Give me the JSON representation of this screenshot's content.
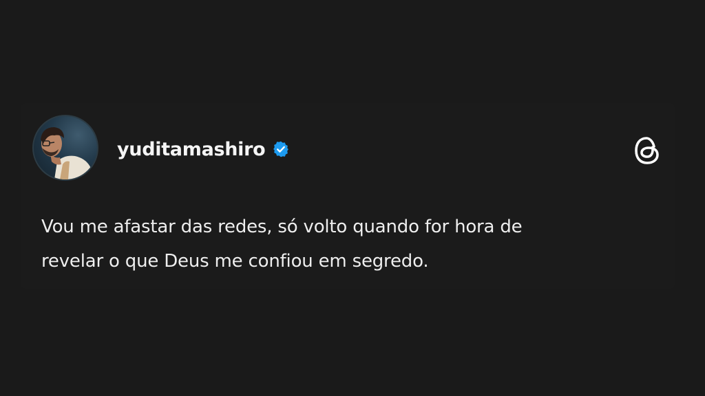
{
  "post": {
    "author": {
      "username": "yuditamashiro",
      "verified": true,
      "avatar": "profile-photo"
    },
    "text_lines": [
      "Vou me afastar das redes, só volto quando for hora de",
      "revelar o que Deus me confiou em segredo."
    ],
    "platform_icon": "threads-logo-icon"
  },
  "colors": {
    "background": "#1a1a1a",
    "text": "#eeeeee",
    "verified_badge": "#1d9bf0"
  }
}
